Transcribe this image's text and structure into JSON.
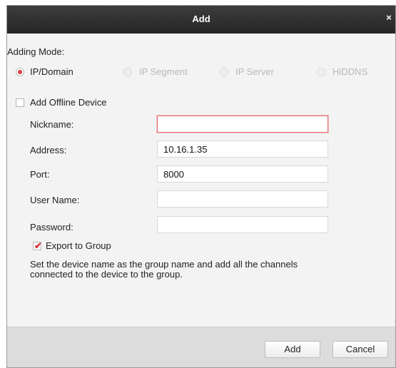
{
  "dialog": {
    "title": "Add",
    "close_glyph": "×"
  },
  "adding_mode": {
    "label": "Adding Mode:",
    "options": [
      {
        "label": "IP/Domain",
        "selected": true
      },
      {
        "label": "IP Segment",
        "selected": false
      },
      {
        "label": "IP Server",
        "selected": false
      },
      {
        "label": "HiDDNS",
        "selected": false
      }
    ]
  },
  "offline": {
    "label": "Add Offline Device",
    "checked": false
  },
  "form": {
    "nickname_label": "Nickname:",
    "nickname_value": "",
    "address_label": "Address:",
    "address_value": "10.16.1.35",
    "port_label": "Port:",
    "port_value": "8000",
    "username_label": "User Name:",
    "username_value": "",
    "password_label": "Password:",
    "password_value": ""
  },
  "export_group": {
    "label": "Export to Group",
    "checked": true,
    "check_glyph": "✔",
    "description": "Set the device name as the group name and add all the channels connected to the device to the group."
  },
  "footer": {
    "add_label": "Add",
    "cancel_label": "Cancel"
  },
  "colors": {
    "accent": "#e23a3a",
    "titlebar": "#2e2e2e",
    "footer": "#dcdcdc"
  }
}
